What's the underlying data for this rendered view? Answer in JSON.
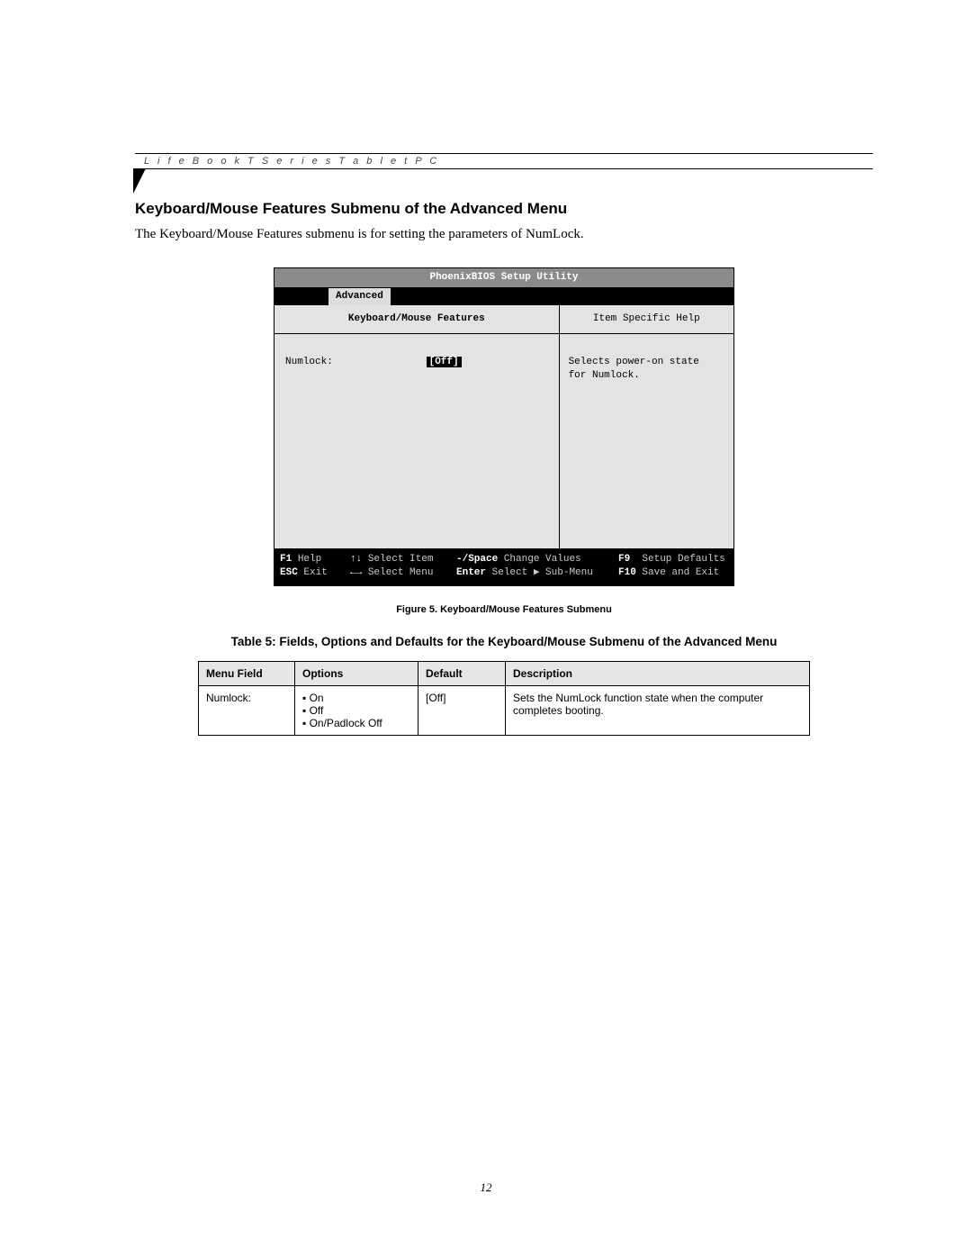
{
  "header_product": "L i f e B o o k   T   S e r i e s   T a b l e t   P C",
  "section_title": "Keyboard/Mouse Features Submenu of the Advanced Menu",
  "section_body": "The Keyboard/Mouse Features submenu is for setting the parameters of NumLock.",
  "bios": {
    "title": "PhoenixBIOS Setup Utility",
    "active_tab": "Advanced",
    "left_header": "Keyboard/Mouse Features",
    "right_header": "Item Specific Help",
    "field_label": "Numlock:",
    "field_value": "[Off]",
    "help_line1": "Selects power-on state",
    "help_line2": "for Numlock.",
    "footer": {
      "r1c1_key": "F1",
      "r1c1_txt": "Help",
      "r1c2_key": "↑↓",
      "r1c2_txt": "Select Item",
      "r1c3_key": "-/Space",
      "r1c3_txt": "Change Values",
      "r1c4_key": "F9",
      "r1c4_txt": "Setup Defaults",
      "r2c1_key": "ESC",
      "r2c1_txt": "Exit",
      "r2c2_key": "←→",
      "r2c2_txt": "Select Menu",
      "r2c3_key": "Enter",
      "r2c3_txt": "Select ▶ Sub-Menu",
      "r2c4_key": "F10",
      "r2c4_txt": "Save and Exit"
    }
  },
  "figure_caption": "Figure 5.   Keyboard/Mouse Features Submenu",
  "table_title": "Table 5: Fields, Options and Defaults for the Keyboard/Mouse Submenu of the Advanced Menu",
  "table": {
    "headers": {
      "c1": "Menu Field",
      "c2": "Options",
      "c3": "Default",
      "c4": "Description"
    },
    "row": {
      "menu_field": "Numlock:",
      "options": [
        "On",
        "Off",
        "On/Padlock Off"
      ],
      "default": "[Off]",
      "description": "Sets the NumLock function state when the computer completes booting."
    }
  },
  "page_number": "12"
}
